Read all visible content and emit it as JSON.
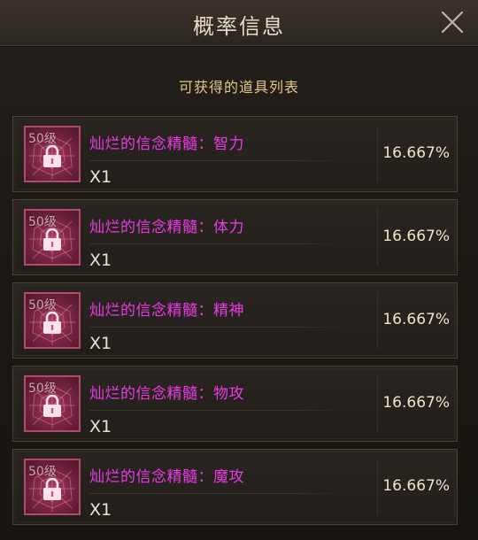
{
  "dialog": {
    "title": "概率信息",
    "close_icon": "close-icon"
  },
  "section": {
    "title": "可获得的道具列表"
  },
  "items": [
    {
      "level": "50级",
      "name": "灿烂的信念精髓：智力",
      "qty": "X1",
      "prob": "16.667%",
      "locked": true
    },
    {
      "level": "50级",
      "name": "灿烂的信念精髓：体力",
      "qty": "X1",
      "prob": "16.667%",
      "locked": true
    },
    {
      "level": "50级",
      "name": "灿烂的信念精髓：精神",
      "qty": "X1",
      "prob": "16.667%",
      "locked": true
    },
    {
      "level": "50级",
      "name": "灿烂的信念精髓：物攻",
      "qty": "X1",
      "prob": "16.667%",
      "locked": true
    },
    {
      "level": "50级",
      "name": "灿烂的信念精髓：魔攻",
      "qty": "X1",
      "prob": "16.667%",
      "locked": true
    }
  ],
  "colors": {
    "item_name": "#ea3be6",
    "subtitle": "#e8c48a",
    "slot_border": "#b04a6e"
  }
}
